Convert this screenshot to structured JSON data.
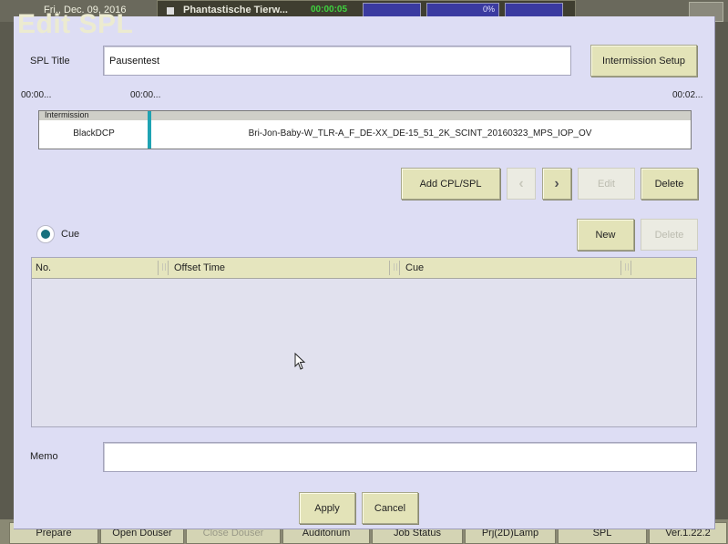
{
  "background": {
    "date": "Fri., Dec. 09, 2016",
    "now_playing_title": "Phantastische Tierw...",
    "now_playing_time": "00:00:05",
    "progress_percent": "0%",
    "bottom_nav": [
      {
        "label": "Prepare",
        "enabled": true
      },
      {
        "label": "Open Douser",
        "enabled": true
      },
      {
        "label": "Close Douser",
        "enabled": false
      },
      {
        "label": "Auditorium",
        "enabled": true
      },
      {
        "label": "Job Status",
        "enabled": true
      },
      {
        "label": "Prj(2D)Lamp",
        "enabled": true
      },
      {
        "label": "SPL",
        "enabled": true
      },
      {
        "label": "Ver.1.22.2",
        "enabled": true
      }
    ]
  },
  "dialog": {
    "title": "Edit SPL",
    "spl_title_label": "SPL Title",
    "spl_title_value": "Pausentest",
    "intermission_setup_label": "Intermission Setup",
    "timeline": {
      "time_start": "00:00...",
      "time_mid": "00:00...",
      "time_end": "00:02...",
      "header_label": "Intermission",
      "item1": "BlackDCP",
      "item2": "Bri-Jon-Baby-W_TLR-A_F_DE-XX_DE-15_51_2K_SCINT_20160323_MPS_IOP_OV"
    },
    "buttons": {
      "add_cpl_spl": "Add CPL/SPL",
      "edit": "Edit",
      "delete": "Delete",
      "new": "New",
      "cue_delete": "Delete",
      "apply": "Apply",
      "cancel": "Cancel"
    },
    "cue_radio_label": "Cue",
    "cue_table": {
      "columns": [
        "No.",
        "Offset Time",
        "Cue"
      ],
      "rows": []
    },
    "memo_label": "Memo",
    "memo_value": ""
  },
  "colors": {
    "dialog_bg": "#ddddf4",
    "button_bg": "#e3e3b8",
    "accent_teal": "#1fa3b3",
    "progress_blue": "#3a3aa0",
    "time_green": "#3fd23f"
  }
}
